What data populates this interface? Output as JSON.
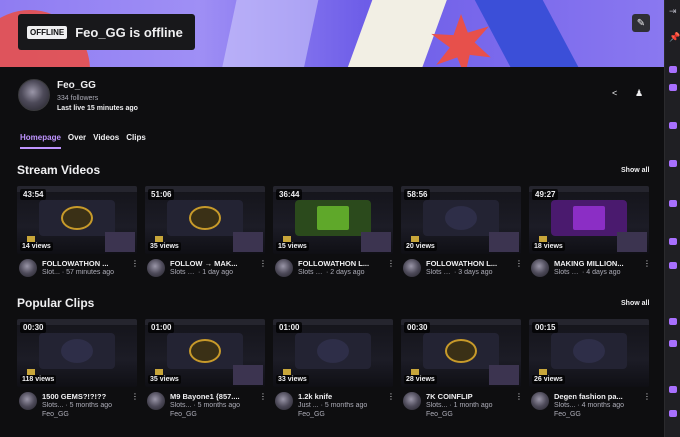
{
  "channel": {
    "offline_tag": "OFFLINE",
    "offline_text": "Feo_GG is offline",
    "name": "Feo_GG",
    "followers": "334 followers",
    "last_live": "Last live 15 minutes ago"
  },
  "tabs": [
    {
      "label": "Homepage"
    },
    {
      "label": "Over"
    },
    {
      "label": "Videos"
    },
    {
      "label": "Clips"
    }
  ],
  "stream_videos": {
    "title": "Stream Videos",
    "show_all": "Show all",
    "items": [
      {
        "duration": "43:54",
        "views": "14 views",
        "title": "FOLLOWATHON ...",
        "category": "Slot...",
        "when": "57 minutes ago"
      },
      {
        "duration": "51:06",
        "views": "35 views",
        "title": "FOLLOW → MAK...",
        "category": "Slots & C...",
        "when": "1 day ago"
      },
      {
        "duration": "36:44",
        "views": "15 views",
        "title": "FOLLOWATHON L...",
        "category": "Slots & ...",
        "when": "2 days ago"
      },
      {
        "duration": "58:56",
        "views": "20 views",
        "title": "FOLLOWATHON L...",
        "category": "Slots & ...",
        "when": "3 days ago"
      },
      {
        "duration": "49:27",
        "views": "18 views",
        "title": "MAKING MILLION...",
        "category": "Slots & ...",
        "when": "4 days ago"
      }
    ]
  },
  "popular_clips": {
    "title": "Popular Clips",
    "show_all": "Show all",
    "items": [
      {
        "duration": "00:30",
        "views": "118 views",
        "title": "1500 GEMS?!?!??",
        "category": "Slots...",
        "when": "5 months ago",
        "user": "Feo_GG"
      },
      {
        "duration": "01:00",
        "views": "35 views",
        "title": "M9 Bayone1 {857....",
        "category": "Slots...",
        "when": "5 months ago",
        "user": "Feo_GG"
      },
      {
        "duration": "01:00",
        "views": "33 views",
        "title": "1.2k knife",
        "category": "Just ...",
        "when": "5 months ago",
        "user": "Feo_GG"
      },
      {
        "duration": "00:30",
        "views": "28 views",
        "title": "7K COINFLIP",
        "category": "Slots...",
        "when": "1 month ago",
        "user": "Feo_GG"
      },
      {
        "duration": "00:15",
        "views": "26 views",
        "title": "Degen fashion pa...",
        "category": "Slots...",
        "when": "4 months ago",
        "user": "Feo_GG"
      }
    ]
  },
  "icons": {
    "edit": "pencil-icon",
    "share": "share-icon",
    "follow": "user-icon",
    "more": "kebab-icon"
  },
  "colors": {
    "accent": "#bf94ff",
    "background": "#0e0e10"
  }
}
